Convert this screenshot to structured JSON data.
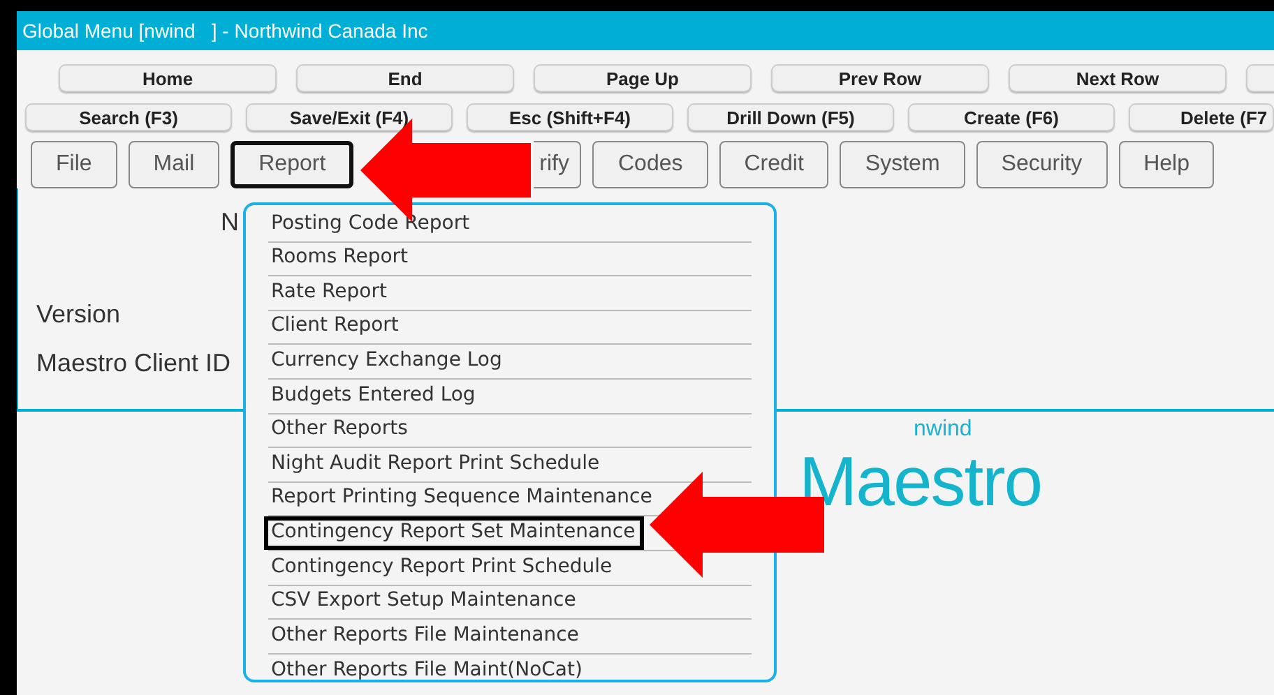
{
  "window": {
    "title": "Global Menu [nwind   ] - Northwind Canada Inc"
  },
  "nav_buttons": [
    {
      "label": "Home"
    },
    {
      "label": "End"
    },
    {
      "label": "Page Up"
    },
    {
      "label": "Prev Row"
    },
    {
      "label": "Next Row"
    }
  ],
  "action_buttons": [
    {
      "label": "Search (F3)"
    },
    {
      "label": "Save/Exit (F4)"
    },
    {
      "label": "Esc (Shift+F4)"
    },
    {
      "label": "Drill Down (F5)"
    },
    {
      "label": "Create (F6)"
    },
    {
      "label": "Delete (F7"
    }
  ],
  "menu_tabs": [
    {
      "label": "File",
      "selected": false
    },
    {
      "label": "Mail",
      "selected": false
    },
    {
      "label": "Report",
      "selected": true
    },
    {
      "label": "rify",
      "selected": false
    },
    {
      "label": "Codes",
      "selected": false
    },
    {
      "label": "Credit",
      "selected": false
    },
    {
      "label": "System",
      "selected": false
    },
    {
      "label": "Security",
      "selected": false
    },
    {
      "label": "Help",
      "selected": false
    }
  ],
  "info": {
    "partial_label": "N",
    "version_label": "Version",
    "client_id_label": "Maestro Client ID"
  },
  "report_menu": [
    {
      "label": "Posting Code Report",
      "highlighted": false
    },
    {
      "label": "Rooms Report",
      "highlighted": false
    },
    {
      "label": "Rate Report",
      "highlighted": false
    },
    {
      "label": "Client Report",
      "highlighted": false
    },
    {
      "label": "Currency Exchange Log",
      "highlighted": false
    },
    {
      "label": "Budgets Entered Log",
      "highlighted": false
    },
    {
      "label": "Other Reports",
      "highlighted": false
    },
    {
      "label": "Night Audit Report Print Schedule",
      "highlighted": false
    },
    {
      "label": "Report Printing Sequence Maintenance",
      "highlighted": false
    },
    {
      "label": "Contingency Report Set Maintenance",
      "highlighted": true
    },
    {
      "label": "Contingency Report Print Schedule",
      "highlighted": false
    },
    {
      "label": "CSV Export Setup Maintenance",
      "highlighted": false
    },
    {
      "label": "Other Reports File Maintenance",
      "highlighted": false
    },
    {
      "label": "Other Reports File Maint(NoCat)",
      "highlighted": false
    }
  ],
  "company_code": "nwind",
  "logo": "Maestro"
}
